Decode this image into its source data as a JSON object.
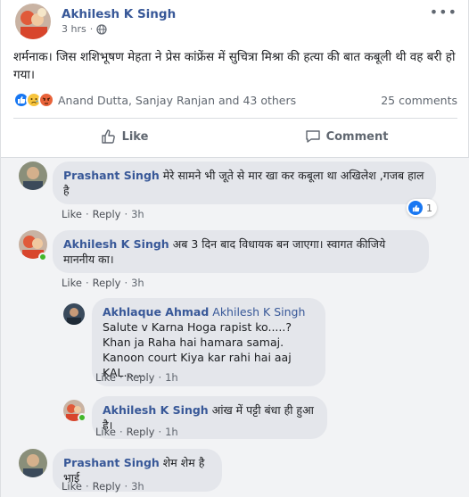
{
  "post": {
    "author": "Akhilesh K Singh",
    "time": "3 hrs",
    "text": "शर्मनाक। जिस शशिभूषण मेहता ने प्रेस कांफ्रेंस में सुचित्रा मिश्रा की हत्या की बात कबूली थी वह बरी हो गया।",
    "reactors": "Anand Dutta, Sanjay Ranjan and 43 others",
    "comments_count": "25 comments",
    "reaction_icons": [
      "like-icon",
      "sad-icon",
      "angry-icon"
    ]
  },
  "actions": {
    "like_label": "Like",
    "comment_label": "Comment"
  },
  "comments": [
    {
      "name": "Prashant Singh",
      "text": "मेरे सामने भी जूते से मार खा कर कबूला था अखिलेश ,गजब हाल है",
      "like": "Like",
      "reply": "Reply",
      "time": "3h",
      "reaction_count": "1"
    },
    {
      "name": "Akhilesh K Singh",
      "text": "अब 3 दिन बाद विधायक बन जाएगा। स्वागत कीजिये माननीय का।",
      "like": "Like",
      "reply": "Reply",
      "time": "3h"
    },
    {
      "name": "Akhlaque Ahmad",
      "mention": "Akhilesh K Singh",
      "lines": [
        "Salute v Karna Hoga rapist ko.....?",
        "Khan ja Raha hai hamara samaj.",
        "Kanoon court Kiya kar rahi hai aaj KAL......"
      ],
      "like": "Like",
      "reply": "Reply",
      "time": "1h"
    },
    {
      "name": "Akhilesh K Singh",
      "text": "आंख में पट्टी बंधा ही हुआ है।",
      "like": "Like",
      "reply": "Reply",
      "time": "1h"
    },
    {
      "name": "Prashant Singh",
      "text": "शेम शेम है भाई",
      "like": "Like",
      "reply": "Reply",
      "time": "3h"
    }
  ],
  "colors": {
    "link_blue": "#385898",
    "like_blue": "#1877f2",
    "online_green": "#42b72a",
    "bubble_bg": "#e4e6eb"
  }
}
